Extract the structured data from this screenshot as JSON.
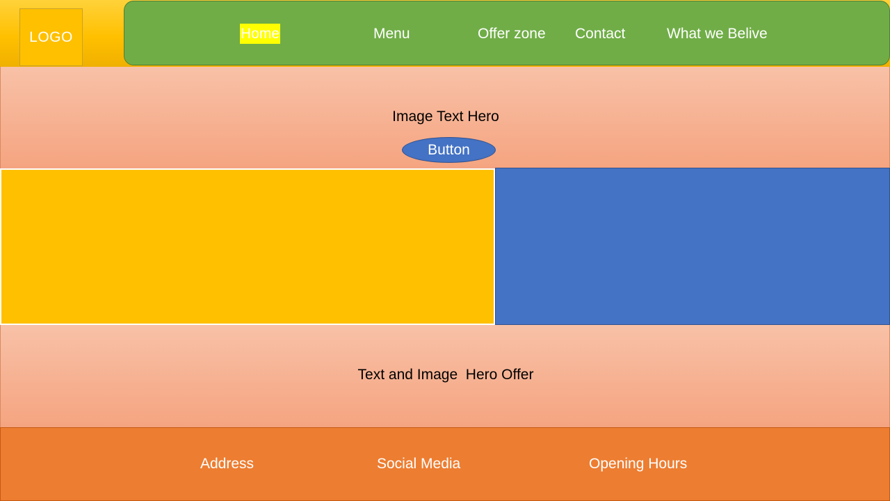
{
  "header": {
    "logo": "LOGO",
    "nav": {
      "home": "Home",
      "menu": "Menu",
      "offer_zone": "Offer zone",
      "contact": "Contact",
      "about": "What we Belive"
    }
  },
  "hero": {
    "title": "Image Text Hero",
    "button": "Button"
  },
  "offer": {
    "text": "Text and Image  Hero Offer"
  },
  "footer": {
    "address": "Address",
    "social": "Social Media",
    "hours": "Opening Hours"
  },
  "colors": {
    "header_bg": "#ffc000",
    "nav_bg": "#70ad47",
    "active_highlight": "#ffff00",
    "hero_bg": "#f8c1a7",
    "button_bg": "#4472c4",
    "panel_left": "#ffc000",
    "panel_right": "#4472c4",
    "footer_bg": "#ed7d31"
  }
}
